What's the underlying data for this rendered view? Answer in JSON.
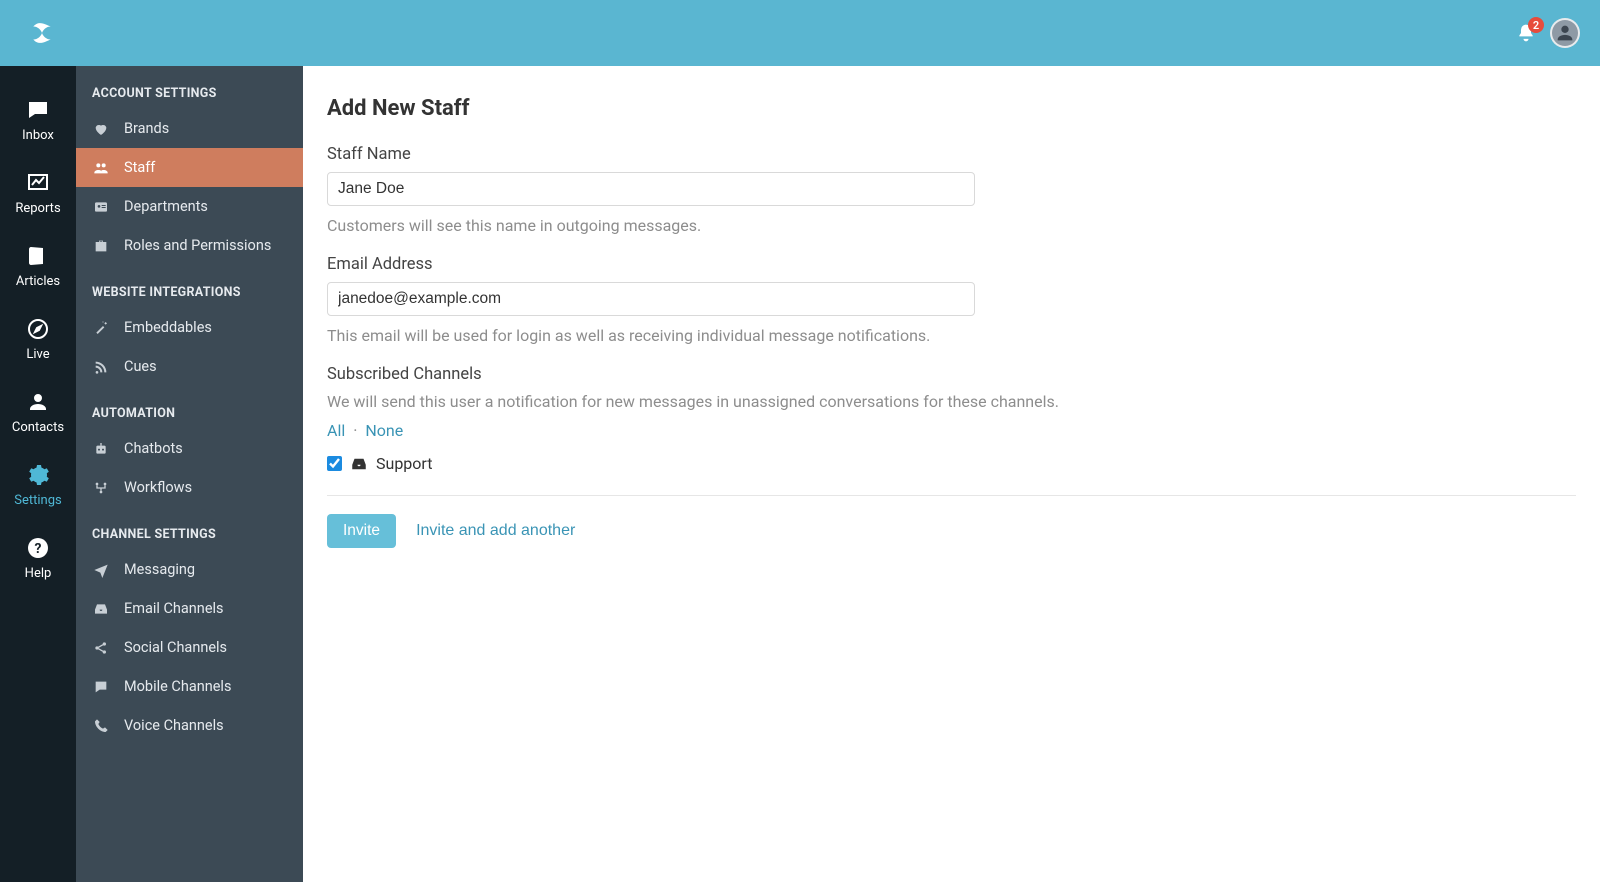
{
  "topbar": {
    "notification_count": "2"
  },
  "nav": {
    "items": [
      {
        "label": "Inbox"
      },
      {
        "label": "Reports"
      },
      {
        "label": "Articles"
      },
      {
        "label": "Live"
      },
      {
        "label": "Contacts"
      },
      {
        "label": "Settings"
      },
      {
        "label": "Help"
      }
    ]
  },
  "settings_panel": {
    "sections": [
      {
        "title": "ACCOUNT SETTINGS",
        "items": [
          {
            "label": "Brands"
          },
          {
            "label": "Staff"
          },
          {
            "label": "Departments"
          },
          {
            "label": "Roles and Permissions"
          }
        ]
      },
      {
        "title": "WEBSITE INTEGRATIONS",
        "items": [
          {
            "label": "Embeddables"
          },
          {
            "label": "Cues"
          }
        ]
      },
      {
        "title": "AUTOMATION",
        "items": [
          {
            "label": "Chatbots"
          },
          {
            "label": "Workflows"
          }
        ]
      },
      {
        "title": "CHANNEL SETTINGS",
        "items": [
          {
            "label": "Messaging"
          },
          {
            "label": "Email Channels"
          },
          {
            "label": "Social Channels"
          },
          {
            "label": "Mobile Channels"
          },
          {
            "label": "Voice Channels"
          }
        ]
      }
    ]
  },
  "main": {
    "title": "Add New Staff",
    "staff_name_label": "Staff Name",
    "staff_name_value": "Jane Doe",
    "staff_name_help": "Customers will see this name in outgoing messages.",
    "email_label": "Email Address",
    "email_value": "janedoe@example.com",
    "email_help": "This email will be used for login as well as receiving individual message notifications.",
    "channels_label": "Subscribed Channels",
    "channels_help": "We will send this user a notification for new messages in unassigned conversations for these channels.",
    "link_all": "All",
    "link_sep": "·",
    "link_none": "None",
    "channels": [
      {
        "label": "Support",
        "checked": true
      }
    ],
    "btn_invite": "Invite",
    "btn_invite_another": "Invite and add another"
  }
}
